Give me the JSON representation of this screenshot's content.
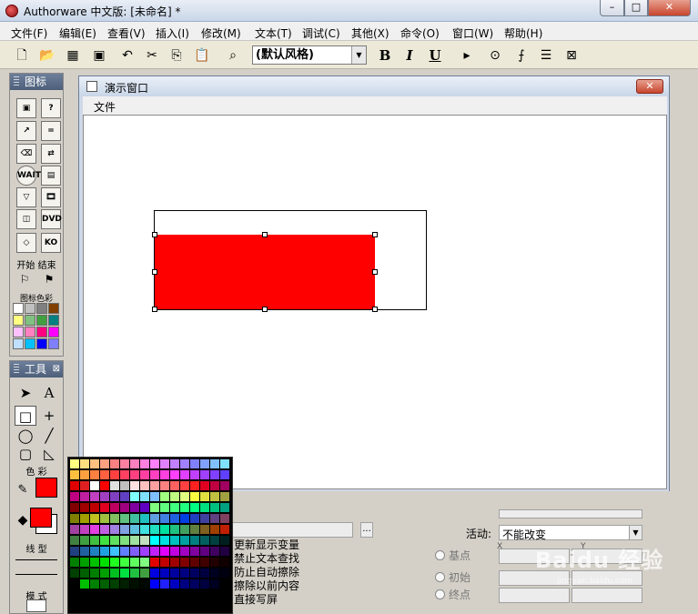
{
  "app": {
    "title": "Authorware 中文版: [未命名] *"
  },
  "window_buttons": {
    "minimize": "–",
    "maximize": "□",
    "close": "✕"
  },
  "menubar": [
    "文件(F)",
    "编辑(E)",
    "查看(V)",
    "插入(I)",
    "修改(M)",
    "文本(T)",
    "调试(C)",
    "其他(X)",
    "命令(O)",
    "窗口(W)",
    "帮助(H)"
  ],
  "toolbar": {
    "style_value": "(默认风格)",
    "bold": "B",
    "italic": "I",
    "underline": "U"
  },
  "icons_panel": {
    "title": "图标",
    "wait_label": "WAIT",
    "dvd_label": "DVD",
    "ko_label": "KO",
    "start_end_label": "开始 结束",
    "icon_color_label": "图标色彩",
    "palette": [
      "#ffffff",
      "#c0c0c0",
      "#808080",
      "#804000",
      "#ffff80",
      "#80c080",
      "#40a040",
      "#008080",
      "#ffc0ff",
      "#ff80c0",
      "#ff0080",
      "#ff00ff",
      "#c0e0ff",
      "#00c0ff",
      "#0000ff",
      "#8080ff"
    ]
  },
  "tools_panel": {
    "title": "工具",
    "color_label": "色 彩",
    "line_label": "线 型",
    "mode_label": "模 式",
    "fill_color": "#ff0000",
    "line_color": "#ff0000"
  },
  "presentation_window": {
    "title": "演示窗口",
    "menu_file": "文件",
    "shape_fill": "#ff0000"
  },
  "properties": {
    "options": [
      "更新显示变量",
      "禁止文本查找",
      "防止自动擦除",
      "擦除以前内容",
      "直接写屏"
    ],
    "active_label": "活动:",
    "active_value": "不能改变",
    "base_point": "基点",
    "initial": "初始",
    "end_point": "终点",
    "x_label": "X",
    "y_label": "Y",
    "ellipsis": "..."
  },
  "watermark": {
    "brand": "Baidu 经验",
    "url": "jingyan.baidu.com"
  }
}
